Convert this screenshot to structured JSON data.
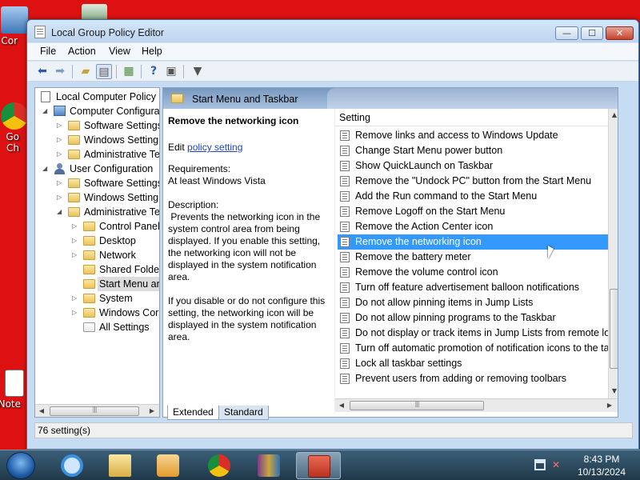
{
  "desktop": {
    "icons": [
      {
        "label": "Cor",
        "icon": "computer-icon"
      },
      {
        "label": "Go\nCh",
        "icon": "chrome-shortcut-icon"
      },
      {
        "label": "Note",
        "icon": "notepad-shortcut-icon"
      }
    ]
  },
  "window": {
    "title": "Local Group Policy Editor",
    "controls": {
      "minimize": "—",
      "maximize": "☐",
      "close": "✕"
    },
    "menu": [
      "File",
      "Action",
      "View",
      "Help"
    ]
  },
  "tree": {
    "items": [
      {
        "label": "Local Computer Policy",
        "icon": "policy-doc-icon",
        "arrow": "",
        "indent": 0
      },
      {
        "label": "Computer Configura",
        "icon": "computer-config-icon",
        "arrow": "◢",
        "indent": 1
      },
      {
        "label": "Software Settings",
        "icon": "folder-icon",
        "arrow": "▷",
        "indent": 2
      },
      {
        "label": "Windows Setting",
        "icon": "folder-icon",
        "arrow": "▷",
        "indent": 2
      },
      {
        "label": "Administrative Te",
        "icon": "folder-icon",
        "arrow": "▷",
        "indent": 2
      },
      {
        "label": "User Configuration",
        "icon": "user-config-icon",
        "arrow": "◢",
        "indent": 1
      },
      {
        "label": "Software Settings",
        "icon": "folder-icon",
        "arrow": "▷",
        "indent": 2
      },
      {
        "label": "Windows Setting",
        "icon": "folder-icon",
        "arrow": "▷",
        "indent": 2
      },
      {
        "label": "Administrative Te",
        "icon": "folder-open-icon",
        "arrow": "◢",
        "indent": 2
      },
      {
        "label": "Control Panel",
        "icon": "folder-icon",
        "arrow": "▷",
        "indent": 3
      },
      {
        "label": "Desktop",
        "icon": "folder-icon",
        "arrow": "▷",
        "indent": 3
      },
      {
        "label": "Network",
        "icon": "folder-icon",
        "arrow": "▷",
        "indent": 3
      },
      {
        "label": "Shared Folder",
        "icon": "folder-icon",
        "arrow": "",
        "indent": 3
      },
      {
        "label": "Start Menu ar",
        "icon": "folder-icon",
        "arrow": "",
        "indent": 3,
        "selected": true
      },
      {
        "label": "System",
        "icon": "folder-icon",
        "arrow": "▷",
        "indent": 3
      },
      {
        "label": "Windows Cor",
        "icon": "folder-icon",
        "arrow": "▷",
        "indent": 3
      },
      {
        "label": "All Settings",
        "icon": "all-settings-icon",
        "arrow": "",
        "indent": 3
      }
    ]
  },
  "pane": {
    "header_title": "Start Menu and Taskbar",
    "description": {
      "title": "Remove the networking icon",
      "edit_prefix": "Edit ",
      "edit_link": "policy setting ",
      "requirements_label": "Requirements:",
      "requirements_value": "At least Windows Vista",
      "description_label": "Description:",
      "paragraph1": " Prevents the networking icon in the system control area from being displayed. If you enable this setting, the networking icon will not be displayed in the system notification area.",
      "paragraph2": "If you disable or do not configure this setting, the networking icon will be displayed in the system notification area."
    },
    "column_header": "Setting",
    "settings": [
      "Remove links and access to Windows Update",
      "Change Start Menu power button",
      "Show QuickLaunch on Taskbar",
      "Remove the \"Undock PC\" button from the Start Menu",
      "Add the Run command to the Start Menu",
      "Remove Logoff on the Start Menu",
      "Remove the Action Center icon",
      "Remove the networking icon",
      "Remove the battery meter",
      "Remove the volume control icon",
      "Turn off feature advertisement balloon notifications",
      "Do not allow pinning items in Jump Lists",
      "Do not allow pinning programs to the Taskbar",
      "Do not display or track items in Jump Lists from remote loca...",
      "Turn off automatic promotion of notification icons to the ta...",
      "Lock all taskbar settings",
      "Prevent users from adding or removing toolbars"
    ],
    "selected_index": 7,
    "tabs": [
      "Extended",
      "Standard"
    ]
  },
  "status": {
    "text": "76 setting(s)"
  },
  "taskbar": {
    "apps": [
      "internet-explorer-icon",
      "file-explorer-icon",
      "media-player-icon",
      "chrome-icon",
      "winrar-icon",
      "group-policy-editor-icon"
    ],
    "time": "8:43 PM",
    "date": "10/13/2024"
  }
}
